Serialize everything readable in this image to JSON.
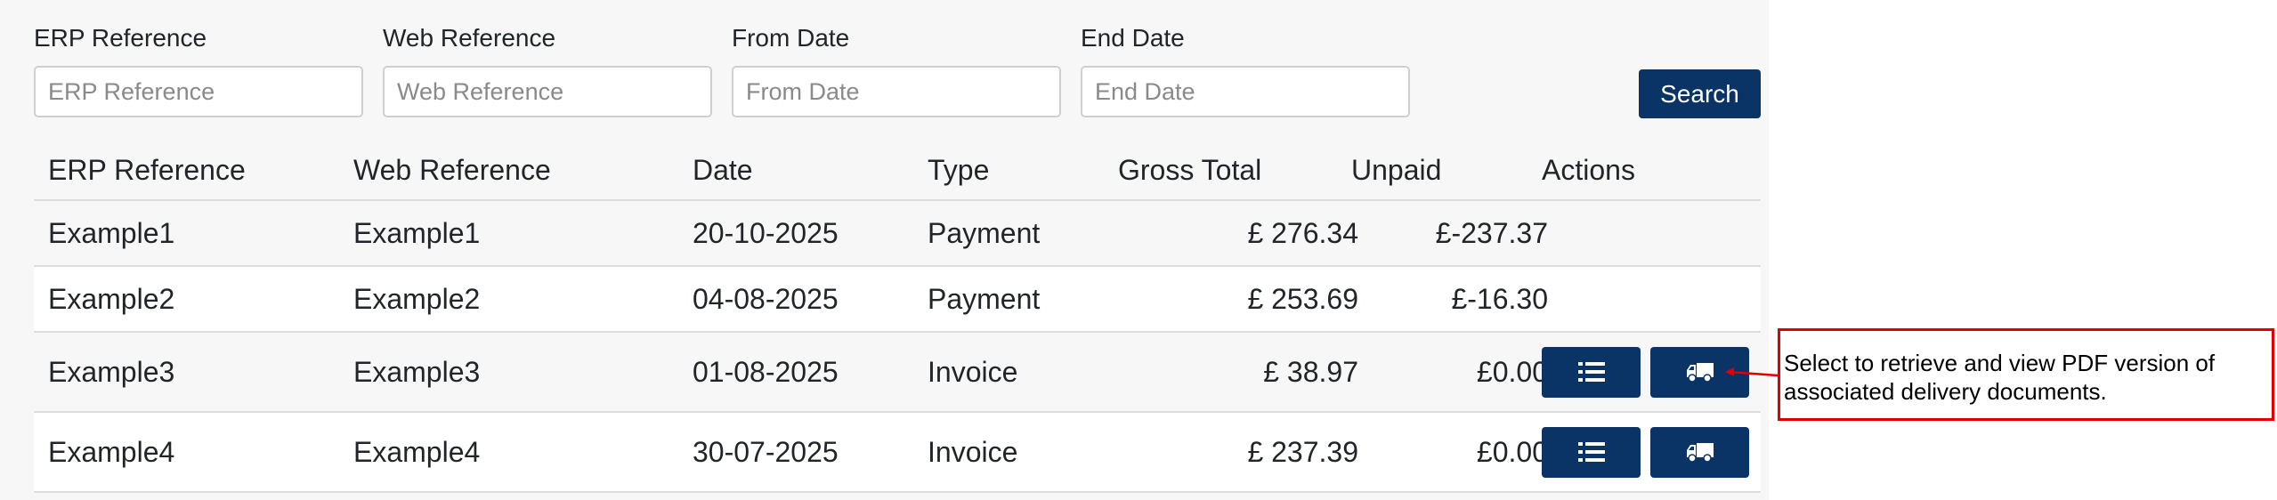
{
  "filters": {
    "erp": {
      "label": "ERP Reference",
      "placeholder": "ERP Reference"
    },
    "web": {
      "label": "Web Reference",
      "placeholder": "Web Reference"
    },
    "from": {
      "label": "From Date",
      "placeholder": "From Date"
    },
    "end": {
      "label": "End Date",
      "placeholder": "End Date"
    },
    "search_label": "Search"
  },
  "table": {
    "headers": [
      "ERP Reference",
      "Web Reference",
      "Date",
      "Type",
      "Gross Total",
      "Unpaid",
      "Actions"
    ],
    "rows": [
      {
        "erp": "Example1",
        "web": "Example1",
        "date": "20-10-2025",
        "type": "Payment",
        "gross": "£ 276.34",
        "unpaid": "£-237.37",
        "actions": []
      },
      {
        "erp": "Example2",
        "web": "Example2",
        "date": "04-08-2025",
        "type": "Payment",
        "gross": "£ 253.69",
        "unpaid": "£-16.30",
        "actions": []
      },
      {
        "erp": "Example3",
        "web": "Example3",
        "date": "01-08-2025",
        "type": "Invoice",
        "gross": "£ 38.97",
        "unpaid": "£0.00",
        "actions": [
          "list-icon",
          "truck-icon"
        ]
      },
      {
        "erp": "Example4",
        "web": "Example4",
        "date": "30-07-2025",
        "type": "Invoice",
        "gross": "£ 237.39",
        "unpaid": "£0.00",
        "actions": [
          "list-icon",
          "truck-icon"
        ]
      }
    ]
  },
  "annotation": {
    "text": "Select to retrieve and view PDF version of associated delivery documents."
  },
  "colors": {
    "primary": "#0a3366",
    "annotation": "#e00000",
    "panel": "#f7f7f7"
  }
}
